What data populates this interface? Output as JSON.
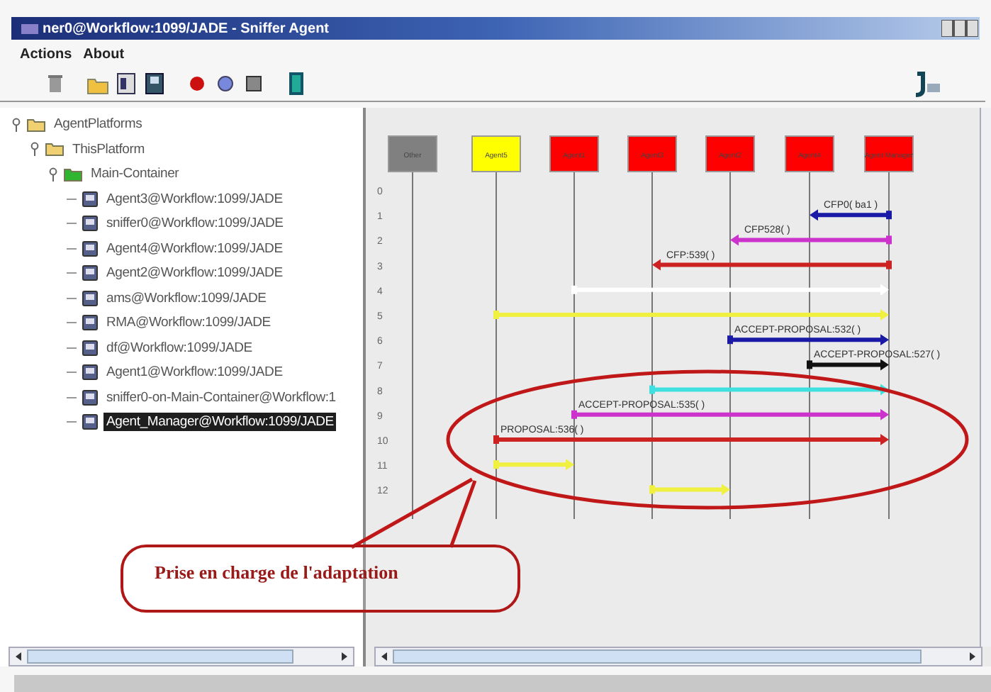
{
  "window": {
    "title": "ner0@Workflow:1099/JADE - Sniffer Agent"
  },
  "menu": [
    "Actions",
    "About"
  ],
  "tree": [
    {
      "label": "AgentPlatforms",
      "kind": "folder",
      "expanded": true,
      "children": [
        {
          "label": "ThisPlatform",
          "kind": "folder",
          "expanded": true,
          "children": [
            {
              "label": "Main-Container",
              "kind": "container",
              "expanded": true,
              "children": [
                {
                  "label": "Agent3@Workflow:1099/JADE",
                  "kind": "agent",
                  "selected": false
                },
                {
                  "label": "sniffer0@Workflow:1099/JADE",
                  "kind": "agent",
                  "selected": false
                },
                {
                  "label": "Agent4@Workflow:1099/JADE",
                  "kind": "agent",
                  "selected": false
                },
                {
                  "label": "Agent2@Workflow:1099/JADE",
                  "kind": "agent",
                  "selected": false
                },
                {
                  "label": "ams@Workflow:1099/JADE",
                  "kind": "agent",
                  "selected": false
                },
                {
                  "label": "RMA@Workflow:1099/JADE",
                  "kind": "agent",
                  "selected": false
                },
                {
                  "label": "df@Workflow:1099/JADE",
                  "kind": "agent",
                  "selected": false
                },
                {
                  "label": "Agent1@Workflow:1099/JADE",
                  "kind": "agent",
                  "selected": false
                },
                {
                  "label": "sniffer0-on-Main-Container@Workflow:1",
                  "kind": "agent",
                  "selected": false
                },
                {
                  "label": "Agent_Manager@Workflow:1099/JADE",
                  "kind": "agent",
                  "selected": true
                }
              ]
            }
          ]
        }
      ]
    }
  ],
  "diagram": {
    "agents": [
      {
        "label": "Other",
        "color": "#808080"
      },
      {
        "label": "Agent5",
        "color": "#ffff00"
      },
      {
        "label": "Agent1",
        "color": "#ff0000"
      },
      {
        "label": "Agent3",
        "color": "#ff0000"
      },
      {
        "label": "Agent2",
        "color": "#ff0000"
      },
      {
        "label": "Agent4",
        "color": "#ff0000"
      },
      {
        "label": "Agent Manager",
        "color": "#ff0000"
      }
    ],
    "rows": [
      {
        "number": "0"
      },
      {
        "number": "1",
        "message": {
          "color": "#1a1aa6",
          "label": "CFP0( ba1 )"
        }
      },
      {
        "number": "2",
        "message": {
          "color": "#cc33cc",
          "label": "CFP528(     )"
        }
      },
      {
        "number": "3",
        "message": {
          "color": "#cc2222",
          "label": "CFP:539(     )"
        }
      },
      {
        "number": "4",
        "message": {
          "color": "#ffffff"
        }
      },
      {
        "number": "5",
        "message": {
          "color": "#f0f040"
        }
      },
      {
        "number": "6",
        "message": {
          "color": "#1a1aa6",
          "label": "ACCEPT-PROPOSAL:532(     )"
        }
      },
      {
        "number": "7",
        "message": {
          "color": "#111111",
          "label": "ACCEPT-PROPOSAL:527(     )"
        }
      },
      {
        "number": "8",
        "message": {
          "color": "#40e0e0"
        }
      },
      {
        "number": "9",
        "message": {
          "color": "#cc33cc",
          "label": "ACCEPT-PROPOSAL:535(     )"
        }
      },
      {
        "number": "10",
        "message": {
          "color": "#cc2222",
          "label": "PROPOSAL:536(     )"
        }
      },
      {
        "number": "11",
        "message": {
          "color": "#f0f040"
        }
      },
      {
        "number": "12",
        "message": {
          "color": "#f0f040"
        }
      }
    ]
  },
  "annotation": {
    "text": "Prise en charge de l'adaptation"
  }
}
